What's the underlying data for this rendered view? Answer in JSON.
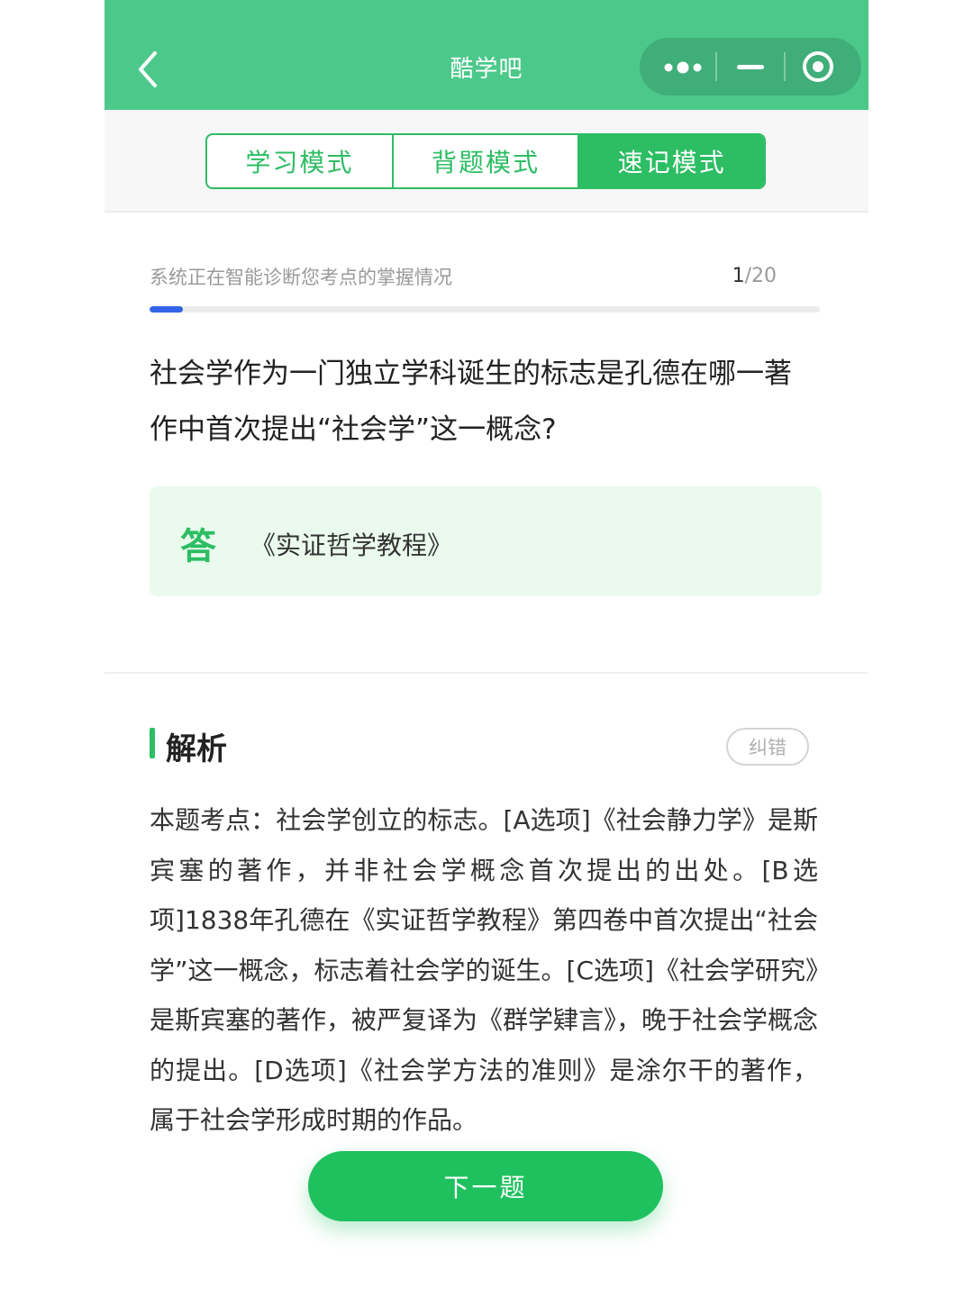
{
  "header": {
    "title": "酷学吧",
    "back_icon": "chevron-left-icon",
    "more_icon": "more-dots-icon",
    "minimize_icon": "minimize-icon",
    "close_icon": "target-circle-icon",
    "colors": {
      "bar": "#4cc98a",
      "capsule": "#3fae78"
    }
  },
  "modes": {
    "tabs": [
      {
        "label": "学习模式"
      },
      {
        "label": "背题模式"
      },
      {
        "label": "速记模式"
      }
    ],
    "active_index": 2,
    "accent": "#2dbd63"
  },
  "progress": {
    "status_text": "系统正在智能诊断您考点的掌握情况",
    "current": "1",
    "total": "/20",
    "fraction": 0.05,
    "fill_color": "#3264e8"
  },
  "question": {
    "text": "社会学作为一门独立学科诞生的标志是孔德在哪一著作中首次提出“社会学”这一概念?"
  },
  "answer": {
    "tag": "答",
    "text": "《实证哲学教程》"
  },
  "analysis": {
    "title": "解析",
    "report_label": "纠错",
    "body": "本题考点：社会学创立的标志。[A选项]《社会静力学》是斯宾塞的著作，并非社会学概念首次提出的出处。[B选项]1838年孔德在《实证哲学教程》第四卷中首次提出“社会学”这一概念，标志着社会学的诞生。[C选项]《社会学研究》是斯宾塞的著作，被严复译为《群学肄言》，晚于社会学概念的提出。[D选项]《社会学方法的准则》是涂尔干的著作，属于社会学形成时期的作品。"
  },
  "footer": {
    "next_label": "下一题",
    "color": "#1fc15e"
  }
}
